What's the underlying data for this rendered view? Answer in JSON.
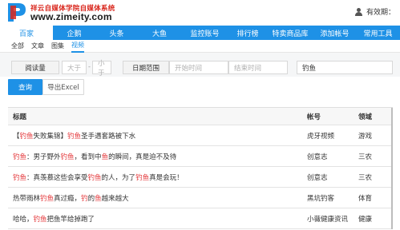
{
  "header": {
    "logo_cn": "祥云自媒体学院自媒体系统",
    "logo_url": "www.zimeity.com",
    "user_text": "有效期：",
    "icons": {
      "user": "user-icon"
    }
  },
  "nav": {
    "items": [
      "百家",
      "企鹅",
      "头条",
      "大鱼",
      "监控账号",
      "排行榜",
      "特卖商品库",
      "添加帐号",
      "常用工具"
    ],
    "active_index": 0
  },
  "subnav": {
    "items": [
      "全部",
      "文章",
      "图集",
      "视频"
    ],
    "active_index": 3
  },
  "filter": {
    "read_label": "阅读量",
    "gt_placeholder": "大于",
    "sep": "-",
    "lt_placeholder": "小于",
    "date_label": "日期范围",
    "start_placeholder": "开始时间",
    "end_placeholder": "结束时间",
    "keyword_value": "钓鱼"
  },
  "buttons": {
    "query": "查询",
    "export": "导出Excel"
  },
  "table": {
    "columns": [
      "标题",
      "帐号",
      "领域"
    ],
    "rows": [
      {
        "title": [
          {
            "t": "【"
          },
          {
            "t": "钓鱼",
            "h": true
          },
          {
            "t": "失败集锦】"
          },
          {
            "t": "钓鱼",
            "h": true
          },
          {
            "t": "圣手遇套路被下水"
          }
        ],
        "account": "虎牙视频",
        "field": "游戏"
      },
      {
        "title": [
          {
            "t": "钓鱼",
            "h": true
          },
          {
            "t": "：男子野外"
          },
          {
            "t": "钓鱼",
            "h": true
          },
          {
            "t": "，看到中"
          },
          {
            "t": "鱼",
            "h": true
          },
          {
            "t": "的瞬间，真是迫不及待"
          }
        ],
        "account": "创意志",
        "field": "三农"
      },
      {
        "title": [
          {
            "t": "钓鱼",
            "h": true
          },
          {
            "t": "：真羡慕这些会享受"
          },
          {
            "t": "钓鱼",
            "h": true
          },
          {
            "t": "的人，为了"
          },
          {
            "t": "钓鱼",
            "h": true
          },
          {
            "t": "真是会玩！"
          }
        ],
        "account": "创意志",
        "field": "三农"
      },
      {
        "title": [
          {
            "t": "热带雨林"
          },
          {
            "t": "钓鱼",
            "h": true
          },
          {
            "t": "真过瘾，"
          },
          {
            "t": "钓",
            "h": true
          },
          {
            "t": "的"
          },
          {
            "t": "鱼",
            "h": true
          },
          {
            "t": "越来越大"
          }
        ],
        "account": "黑坑钓客",
        "field": "体育"
      },
      {
        "title": [
          {
            "t": "哈哈，"
          },
          {
            "t": "钓鱼",
            "h": true
          },
          {
            "t": "把鱼竿给掉跑了"
          }
        ],
        "account": "小薇健康资讯",
        "field": "健康"
      }
    ]
  },
  "colors": {
    "accent": "#1e91e6",
    "highlight": "#e4393c",
    "logo_red": "#d9261c"
  }
}
